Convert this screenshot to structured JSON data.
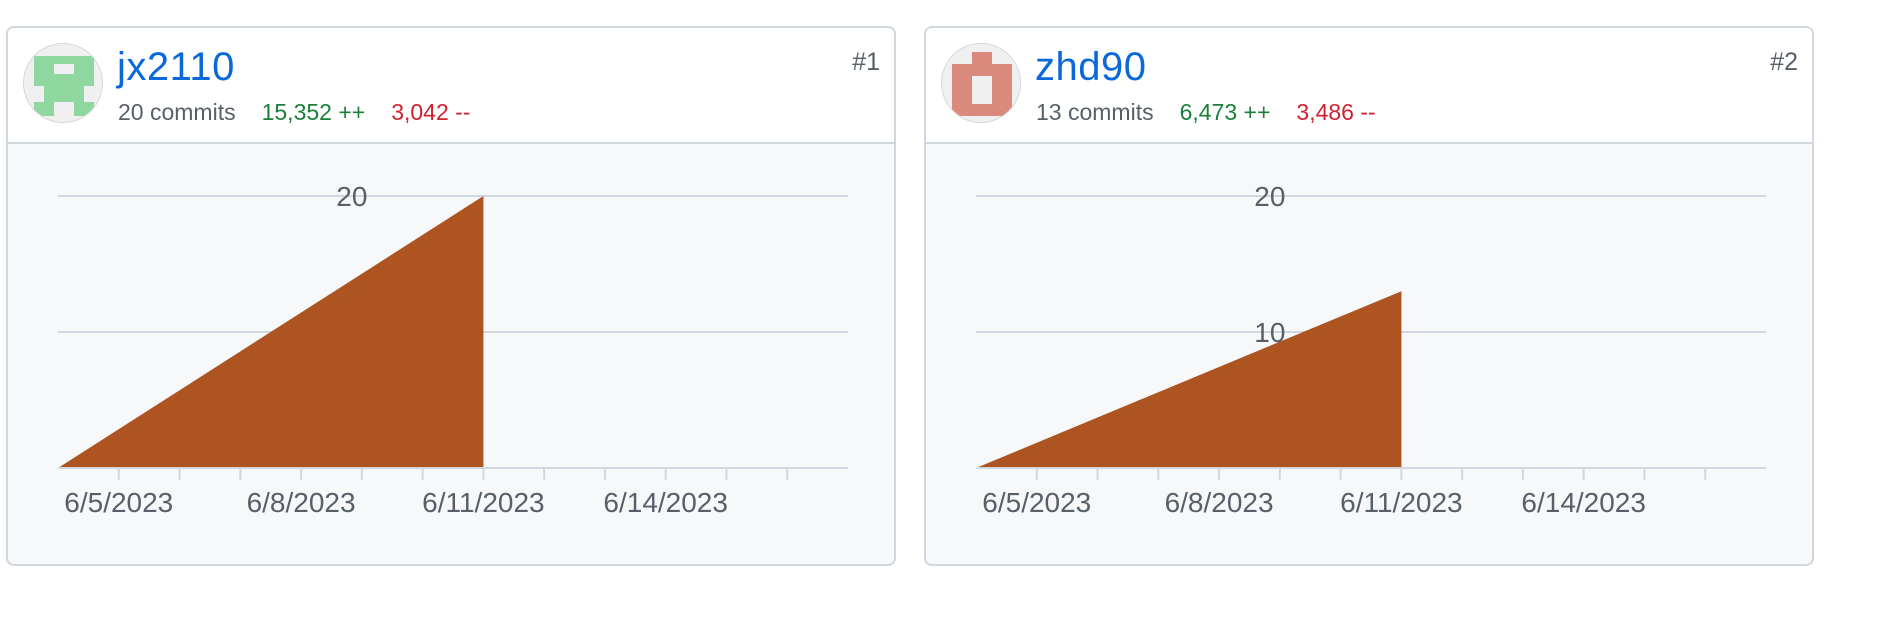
{
  "contributors": [
    {
      "username": "jx2110",
      "commits_label": "20 commits",
      "additions_label": "15,352 ++",
      "deletions_label": "3,042 --",
      "rank": "#1",
      "avatar_color": "#8ed8a0",
      "avatar_icon": "identicon-green"
    },
    {
      "username": "zhd90",
      "commits_label": "13 commits",
      "additions_label": "6,473 ++",
      "deletions_label": "3,486 --",
      "rank": "#2",
      "avatar_color": "#d98a7c",
      "avatar_icon": "identicon-red"
    }
  ],
  "colors": {
    "area_fill": "#ae5421",
    "grid": "#d0d7de",
    "text_muted": "#57606a",
    "link": "#0969da",
    "additions": "#1a7f37",
    "deletions": "#cf222e"
  },
  "chart_data": [
    {
      "type": "area",
      "x_axis_start": "6/4/2023",
      "x_axis_end": "6/17/2023",
      "ylim": [
        0,
        20
      ],
      "y_ticks": [
        10,
        20
      ],
      "x_tick_labels": [
        "6/5/2023",
        "6/8/2023",
        "6/11/2023",
        "6/14/2023"
      ],
      "series": [
        {
          "x": [
            "6/4/2023",
            "6/11/2023",
            "6/11/2023"
          ],
          "y": [
            0,
            20,
            0
          ]
        }
      ]
    },
    {
      "type": "area",
      "x_axis_start": "6/4/2023",
      "x_axis_end": "6/17/2023",
      "ylim": [
        0,
        20
      ],
      "y_ticks": [
        10,
        20
      ],
      "x_tick_labels": [
        "6/5/2023",
        "6/8/2023",
        "6/11/2023",
        "6/14/2023"
      ],
      "series": [
        {
          "x": [
            "6/4/2023",
            "6/11/2023",
            "6/11/2023"
          ],
          "y": [
            0,
            13,
            0
          ]
        }
      ]
    }
  ]
}
